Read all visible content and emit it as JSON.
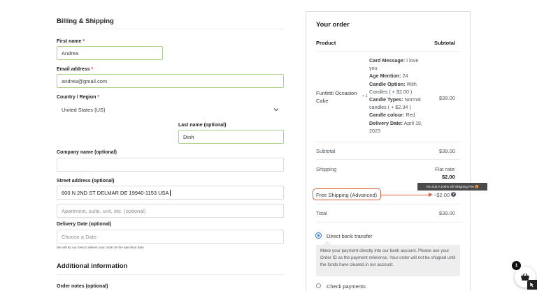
{
  "billing": {
    "title": "Billing & Shipping",
    "first_name": {
      "label": "First name",
      "required_mark": "*",
      "value": "Andrea"
    },
    "email": {
      "label": "Email address",
      "required_mark": "*",
      "value": "andrea@gmail.com"
    },
    "country": {
      "label": "Country / Region",
      "required_mark": "*",
      "value": "United States (US)"
    },
    "last_name": {
      "label": "Last name (optional)",
      "value": "Dinh"
    },
    "company": {
      "label": "Company name (optional)",
      "value": ""
    },
    "street": {
      "label": "Street address (optional)",
      "value": "600 N 2ND ST DELMAR DE 19940-1153 USA",
      "apt_placeholder": "Apartment, suite, unit, etc. (optional)"
    },
    "delivery_date": {
      "label": "Delivery Date (optional)",
      "placeholder": "Choose a Date",
      "help": "We will try our best to deliver your order on the specified date."
    }
  },
  "additional": {
    "title": "Additional information",
    "order_notes_label": "Order notes (optional)"
  },
  "order": {
    "title": "Your order",
    "col_product": "Product",
    "col_subtotal": "Subtotal",
    "item": {
      "name": "Funfetti Occasion Cake",
      "qty": "× 1",
      "price": "$39.00",
      "meta": [
        {
          "key": "Card Message:",
          "value": "I love you"
        },
        {
          "key": "Age Mention:",
          "value": "24"
        },
        {
          "key": "Candle Option:",
          "value": "With Candles ( + $2.00 )"
        },
        {
          "key": "Candle Types:",
          "value": "Normal candles ( + $2.34 )"
        },
        {
          "key": "Candle colour:",
          "value": "Red"
        },
        {
          "key": "Delivery Date:",
          "value": "April 19, 2023"
        }
      ]
    },
    "subtotal_label": "Subtotal",
    "subtotal_value": "$39.00",
    "shipping_label": "Shipping",
    "shipping_rate_label": "Flat rate:",
    "shipping_rate_value": "$2.00",
    "discount_label": "Free Shipping (Advanced)",
    "discount_value": "−$2.00",
    "tooltip": "You Get A 100% Off Shipping Fee 😍",
    "total_label": "Total",
    "total_value": "$39.00"
  },
  "payment": {
    "bank_label": "Direct bank transfer",
    "bank_desc": "Make your payment directly into our bank account. Please use your Order ID as the payment reference. Your order will not be shipped until the funds have cleared in our account.",
    "check_label": "Check payments"
  },
  "cart": {
    "count": "1"
  },
  "colors": {
    "accent": "#1e6fd9",
    "highlight": "#e0603e",
    "filled_border": "#a8d08d"
  }
}
